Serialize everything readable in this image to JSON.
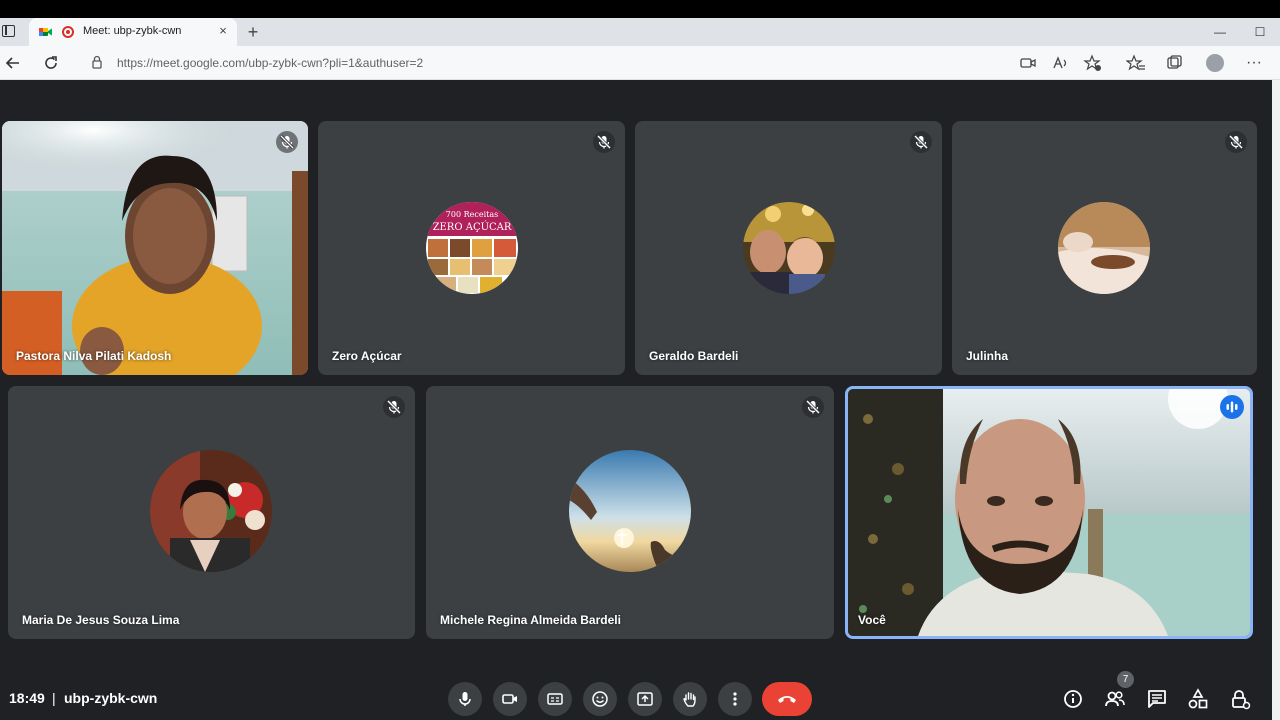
{
  "browser": {
    "tab_title": "Meet: ubp-zybk-cwn",
    "url": "https://meet.google.com/ubp-zybk-cwn?pli=1&authuser=2",
    "new_tab_symbol": "+",
    "close_symbol": "×",
    "minimize_symbol": "—",
    "maximize_symbol": "☐"
  },
  "participants": [
    {
      "name": "Pastora Nilva Pilati Kadosh",
      "muted": true,
      "video": true
    },
    {
      "name": "Zero Açúcar",
      "muted": true,
      "video": false,
      "avatar_text_1": "700 Receitas",
      "avatar_text_2": "ZERO AÇÚCAR"
    },
    {
      "name": "Geraldo Bardeli",
      "muted": true,
      "video": false
    },
    {
      "name": "Julinha",
      "muted": true,
      "video": false
    },
    {
      "name": "Maria De Jesus Souza Lima",
      "muted": true,
      "video": false
    },
    {
      "name": "Michele Regina Almeida Bardeli",
      "muted": true,
      "video": false
    },
    {
      "name": "Você",
      "muted": false,
      "video": true,
      "speaking": true
    }
  ],
  "meeting": {
    "time": "18:49",
    "separator": "|",
    "code": "ubp-zybk-cwn",
    "participant_count": "7"
  },
  "colors": {
    "background": "#202124",
    "tile": "#3c4043",
    "end_call": "#ea4335",
    "active_border": "#8ab4f8"
  }
}
